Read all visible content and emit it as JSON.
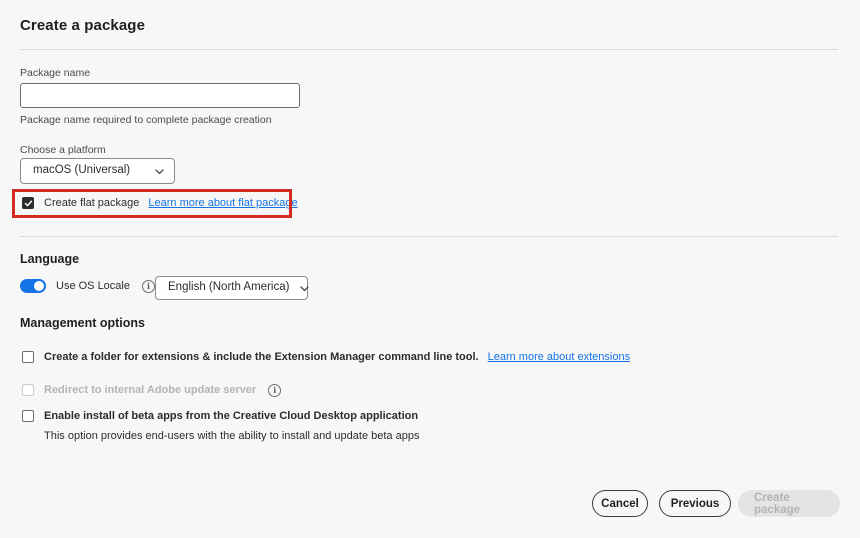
{
  "header": {
    "title": "Create a package"
  },
  "package_name": {
    "label": "Package name",
    "value": "",
    "placeholder": "",
    "helper": "Package name required to complete package creation"
  },
  "platform": {
    "label": "Choose a platform",
    "selected": "macOS (Universal)",
    "options": [
      "macOS (Universal)"
    ]
  },
  "flat_package": {
    "label": "Create flat package",
    "checked": true,
    "link": "Learn more about flat package",
    "highlight_color": "#D32B20"
  },
  "language": {
    "heading": "Language",
    "toggle_label": "Use OS Locale",
    "toggle_on": true,
    "toggle_color": "#1473E6",
    "info_glyph": "i",
    "locale_selected": "English (North America)",
    "locale_options": [
      "English (North America)"
    ]
  },
  "management": {
    "heading": "Management options",
    "rows": [
      {
        "label": "Create a folder for extensions & include the Extension Manager command line tool.",
        "checked": false,
        "disabled": false,
        "link": "Learn more about extensions"
      },
      {
        "label": "Redirect to internal Adobe update server",
        "checked": false,
        "disabled": true,
        "info_glyph": "i"
      },
      {
        "label": "Enable install of beta apps from the Creative Cloud Desktop application",
        "checked": false,
        "disabled": false,
        "sub": "This option provides end-users with the ability to install and update beta apps"
      }
    ]
  },
  "footer": {
    "cancel": "Cancel",
    "previous": "Previous",
    "create": "Create package",
    "create_disabled": true
  },
  "colors": {
    "link": "#1473E6",
    "accent": "#1473E6",
    "highlight": "#D32B20",
    "background": "#F7F7F7"
  }
}
